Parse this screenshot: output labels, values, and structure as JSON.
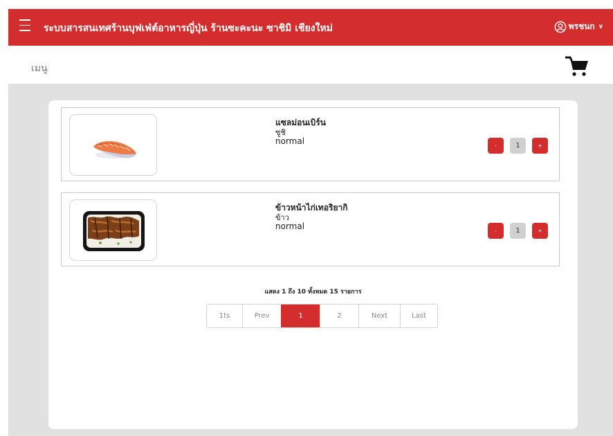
{
  "header": {
    "title": "ระบบสารสนเทศร้านบุฟเฟ่ต์อาหารญี่ปุ่น ร้านซะคะนะ ซาชิมิ เชียงใหม่",
    "user_label": "พรชนก",
    "bg_color": "#d42d2e",
    "menu_icon": "hamburger-icon",
    "user_icon": "user-circle-icon"
  },
  "subheader": {
    "page_label": "เมนู",
    "cart_icon": "shopping-cart-icon"
  },
  "items": [
    {
      "name": "แซลม่อนเบิร์น",
      "category": "ซูชิ",
      "option": "normal",
      "qty": "1",
      "minus": "-",
      "plus": "+",
      "image": "salmon-sushi-image"
    },
    {
      "name": "ข้าวหน้าไก่เทอริยากิ",
      "category": "ข้าว",
      "option": "normal",
      "qty": "1",
      "minus": "-",
      "plus": "+",
      "image": "teriyaki-chicken-rice-image"
    }
  ],
  "pagination": {
    "summary": "แสดง 1 ถึง 10 ทั้งหมด 15 รายการ",
    "buttons": [
      "1ts",
      "Prev",
      "1",
      "2",
      "Next",
      "Last"
    ],
    "active": "1"
  }
}
